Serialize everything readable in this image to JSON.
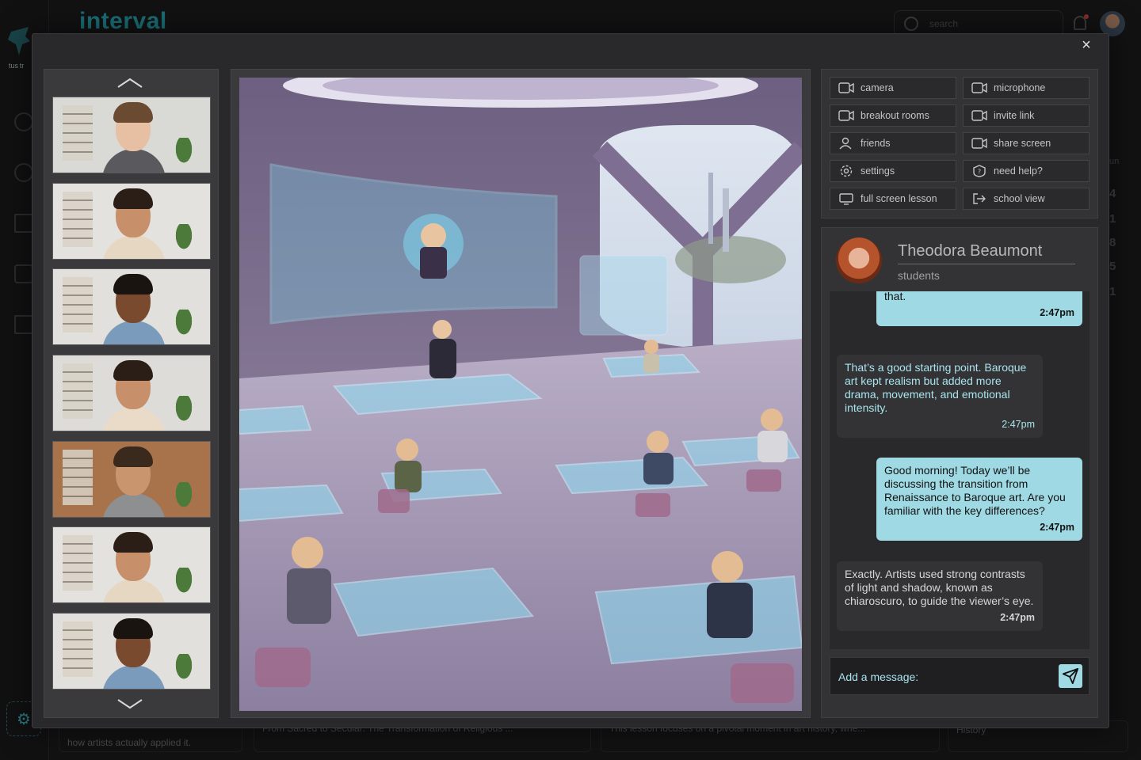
{
  "background": {
    "brand": "interval",
    "logo_text": "tus tr",
    "search_placeholder": "search",
    "right_col_values": [
      "un",
      "4",
      "1",
      "8",
      "5",
      "1"
    ],
    "bottom_cards": [
      "how artists actually applied it.",
      "From Sacred to Secular: The Transformation of Religious ...",
      "This lesson focuses on a pivotal moment in art history, whe...",
      "History"
    ]
  },
  "modal": {
    "close_label": "×",
    "participants": [
      {
        "name": "participant-1",
        "skin": "#e7c0a4",
        "hair": "#6b4a32",
        "shirt": "#5a5a5e",
        "wall": "#d9d9d6"
      },
      {
        "name": "participant-2",
        "skin": "#c8906a",
        "hair": "#2a1e16",
        "shirt": "#e6d7c3",
        "wall": "#e4e2de"
      },
      {
        "name": "participant-3",
        "skin": "#7a4a2e",
        "hair": "#1a1410",
        "shirt": "#7b9bbd",
        "wall": "#e2e0dc"
      },
      {
        "name": "participant-4",
        "skin": "#c8906a",
        "hair": "#2a1e16",
        "shirt": "#eadbc8",
        "wall": "#dedcd8"
      },
      {
        "name": "participant-5",
        "skin": "#c9956e",
        "hair": "#3a2a1e",
        "shirt": "#8d8f90",
        "wall": "#a8734a"
      },
      {
        "name": "participant-6",
        "skin": "#c8906a",
        "hair": "#2a1e16",
        "shirt": "#e6d7c3",
        "wall": "#e4e2de"
      },
      {
        "name": "participant-7",
        "skin": "#7a4a2e",
        "hair": "#1a1410",
        "shirt": "#7b9bbd",
        "wall": "#e2e0dc"
      }
    ],
    "controls": [
      {
        "key": "camera",
        "label": "camera",
        "icon": "camera-icon"
      },
      {
        "key": "microphone",
        "label": "microphone",
        "icon": "camera-icon"
      },
      {
        "key": "breakout",
        "label": "breakout rooms",
        "icon": "camera-icon"
      },
      {
        "key": "invite",
        "label": "invite link",
        "icon": "camera-icon"
      },
      {
        "key": "friends",
        "label": "friends",
        "icon": "user-icon"
      },
      {
        "key": "share",
        "label": "share screen",
        "icon": "camera-icon"
      },
      {
        "key": "settings",
        "label": "settings",
        "icon": "gear-icon"
      },
      {
        "key": "help",
        "label": "need help?",
        "icon": "help-icon"
      },
      {
        "key": "fullscreen",
        "label": "full screen lesson",
        "icon": "screen-icon"
      },
      {
        "key": "school",
        "label": "school view",
        "icon": "exit-icon"
      }
    ],
    "chat": {
      "name": "Theodora Beaumont",
      "role": "students",
      "messages": [
        {
          "from": "me",
          "text": "that.",
          "time": "2:47pm"
        },
        {
          "from": "them",
          "text": "That’s a good starting point. Baroque art kept realism but added more drama, movement, and emotional intensity.",
          "time": "2:47pm"
        },
        {
          "from": "me",
          "text": "Good morning! Today we’ll be discussing the transition from Renaissance to Baroque art. Are you familiar with the key differences?",
          "time": "2:47pm"
        },
        {
          "from": "them-plain",
          "text": "Exactly. Artists used strong contrasts of light and shadow, known as chiaroscuro, to guide the viewer’s eye.",
          "time": "2:47pm"
        }
      ],
      "composer_placeholder": "Add a message:"
    }
  },
  "colors": {
    "accent": "#9fd9e3",
    "accent_text": "#a9e4ee",
    "brand": "#1b6f78"
  }
}
